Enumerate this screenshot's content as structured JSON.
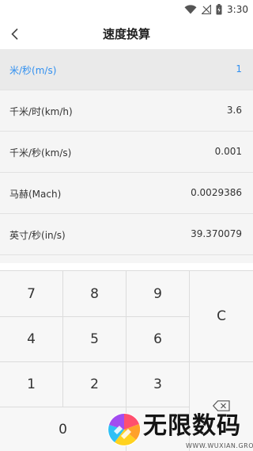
{
  "status_bar": {
    "time": "3:30",
    "icons": [
      "wifi-icon",
      "signal-icon",
      "battery-icon"
    ]
  },
  "header": {
    "back_icon": "chevron-left-icon",
    "title": "速度换算"
  },
  "conversions": [
    {
      "unit": "米/秒(m/s)",
      "value": "1",
      "selected": true
    },
    {
      "unit": "千米/时(km/h)",
      "value": "3.6",
      "selected": false
    },
    {
      "unit": "千米/秒(km/s)",
      "value": "0.001",
      "selected": false
    },
    {
      "unit": "马赫(Mach)",
      "value": "0.0029386",
      "selected": false
    },
    {
      "unit": "英寸/秒(in/s)",
      "value": "39.370079",
      "selected": false
    }
  ],
  "keypad": {
    "k7": "7",
    "k8": "8",
    "k9": "9",
    "k4": "4",
    "k5": "5",
    "k6": "6",
    "k1": "1",
    "k2": "2",
    "k3": "3",
    "k0": "0",
    "clear": "C",
    "backspace_icon": "backspace-icon"
  },
  "watermark": {
    "brand": "无限数码",
    "sub": "WWW.WUXIAN.GROUP"
  },
  "colors": {
    "accent": "#2f8ff0",
    "list_bg": "#f5f5f5",
    "keypad_bg": "#f7f7f7"
  }
}
